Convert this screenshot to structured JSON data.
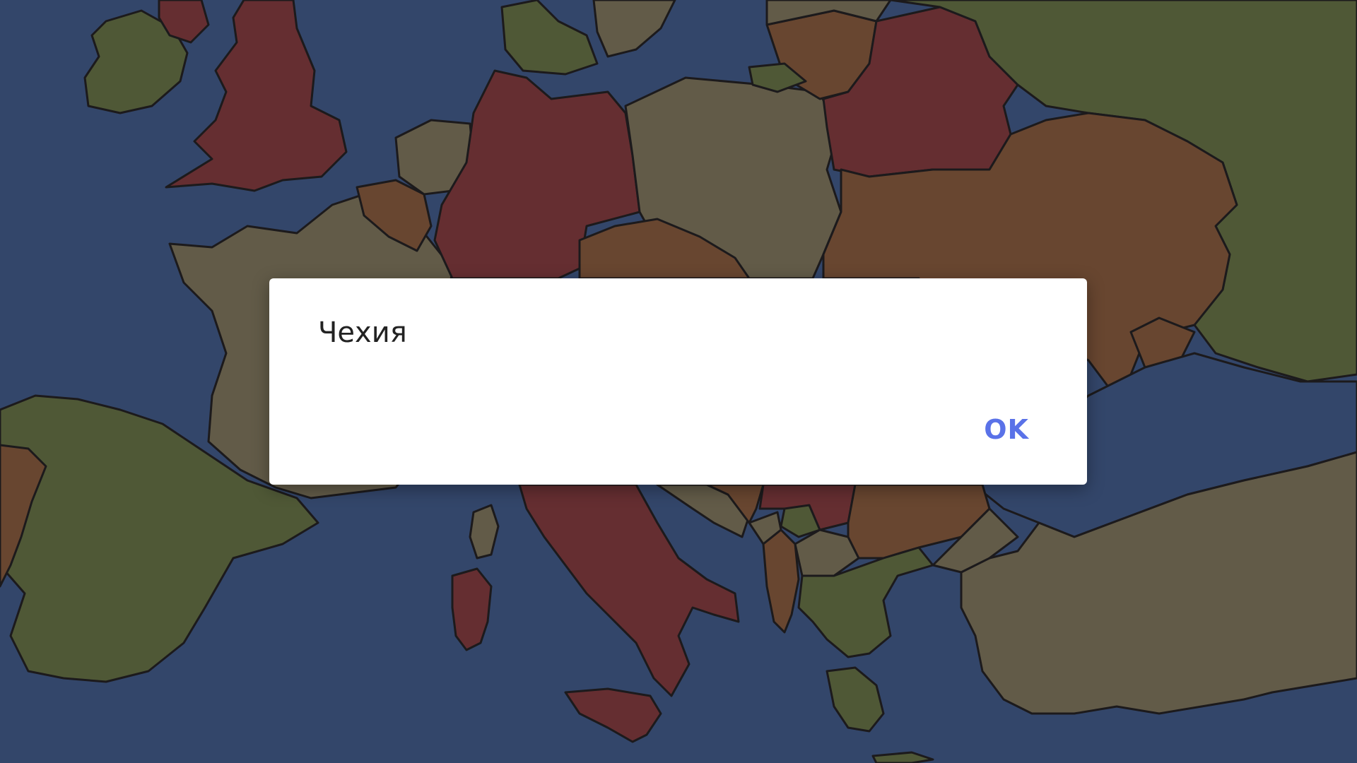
{
  "dialog": {
    "message": "Чехия",
    "ok_label": "OK"
  },
  "colors": {
    "sea": "#33466a",
    "red": "#652e31",
    "olive": "#4f5836",
    "taupe": "#625b48",
    "brown": "#684630",
    "dialog_background": "#ffffff",
    "ok_text": "#5a72e8"
  }
}
